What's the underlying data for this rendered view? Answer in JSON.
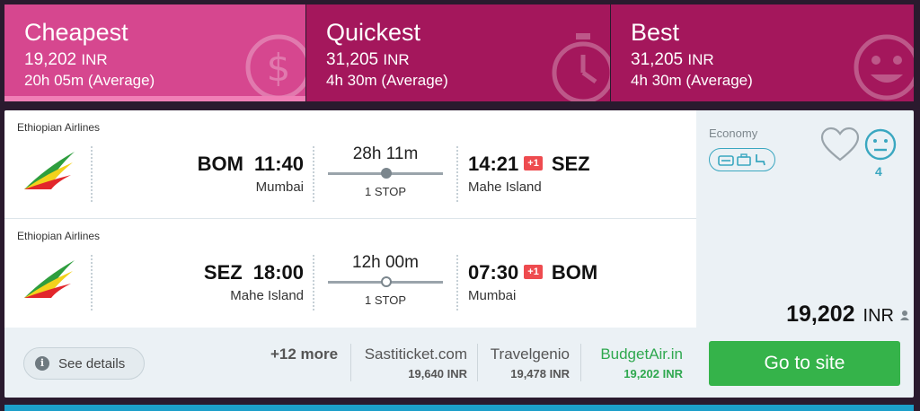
{
  "tabs": {
    "cheapest": {
      "title": "Cheapest",
      "price": "19,202",
      "currency": "INR",
      "duration": "20h 05m (Average)"
    },
    "quickest": {
      "title": "Quickest",
      "price": "31,205",
      "currency": "INR",
      "duration": "4h 30m (Average)"
    },
    "best": {
      "title": "Best",
      "price": "31,205",
      "currency": "INR",
      "duration": "4h 30m (Average)"
    }
  },
  "legs": [
    {
      "airline": "Ethiopian Airlines",
      "dep_code": "BOM",
      "dep_time": "11:40",
      "dep_city": "Mumbai",
      "duration": "28h 11m",
      "stops": "1 STOP",
      "arr_time": "14:21",
      "day_offset": "+1",
      "arr_code": "SEZ",
      "arr_city": "Mahe Island"
    },
    {
      "airline": "Ethiopian Airlines",
      "dep_code": "SEZ",
      "dep_time": "18:00",
      "dep_city": "Mahe Island",
      "duration": "12h 00m",
      "stops": "1 STOP",
      "arr_time": "07:30",
      "day_offset": "+1",
      "arr_code": "BOM",
      "arr_city": "Mumbai"
    }
  ],
  "see_details": "See details",
  "more_providers": "+12 more",
  "providers": [
    {
      "name": "Sastiticket.com",
      "price": "19,640 INR"
    },
    {
      "name": "Travelgenio",
      "price": "19,478 INR"
    },
    {
      "name": "BudgetAir.in",
      "price": "19,202 INR"
    }
  ],
  "cabin": "Economy",
  "score": "4",
  "total_price": "19,202",
  "total_currency": "INR",
  "cta": "Go to site",
  "colors": {
    "cheapest_tab": "#d6478f",
    "other_tabs": "#a4175c",
    "cta_green": "#35b34a",
    "accent_blue": "#3aa7c0",
    "day_offset_red": "#ee4b4f"
  }
}
